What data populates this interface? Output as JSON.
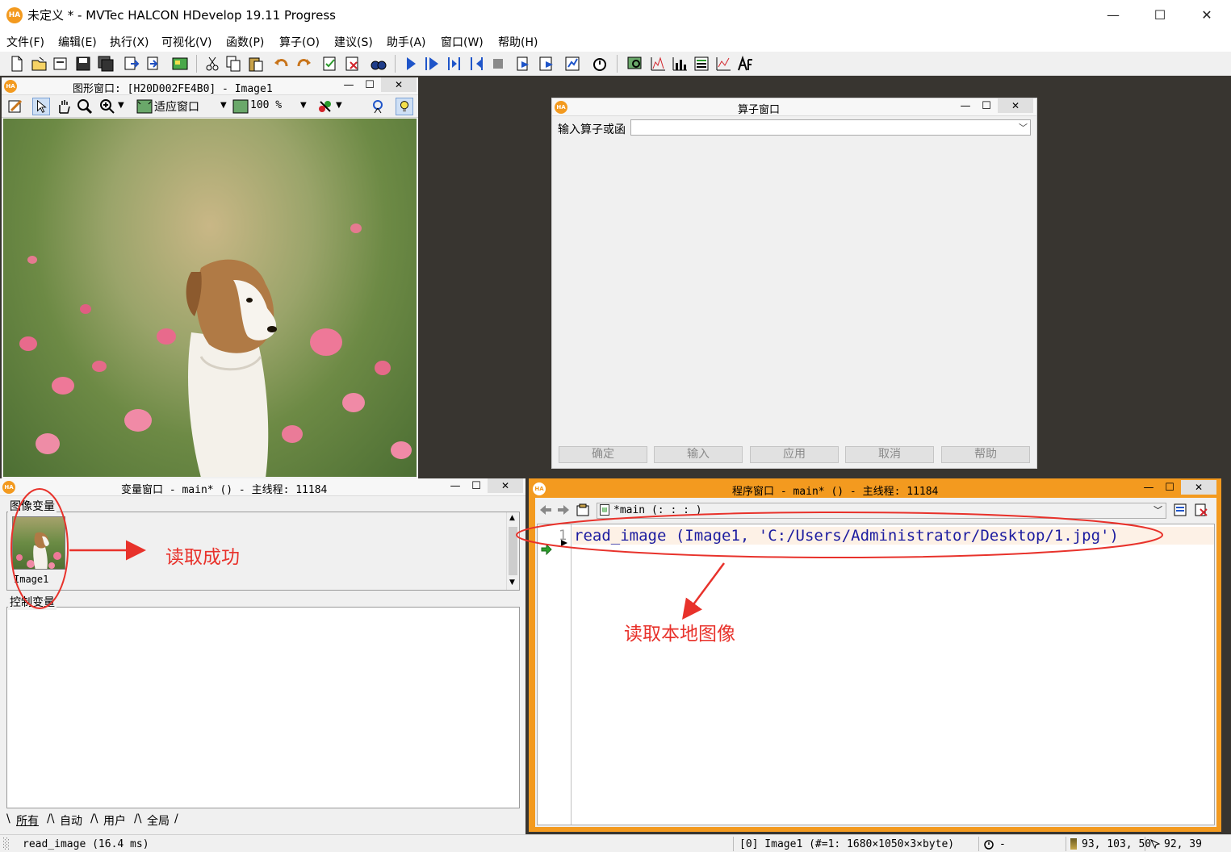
{
  "app": {
    "title": "未定义 * - MVTec HALCON HDevelop 19.11 Progress",
    "logo": "HA"
  },
  "window_controls": {
    "minimize": "—",
    "maximize": "☐",
    "close": "✕"
  },
  "menu": [
    "文件(F)",
    "编辑(E)",
    "执行(X)",
    "可视化(V)",
    "函数(P)",
    "算子(O)",
    "建议(S)",
    "助手(A)",
    "窗口(W)",
    "帮助(H)"
  ],
  "graphics_window": {
    "title": "图形窗口: [H20D002FE4B0] - Image1",
    "fit_label": "适应窗口",
    "zoom_label": "100 %"
  },
  "operator_window": {
    "title": "算子窗口",
    "input_label": "输入算子或函",
    "input_value": "",
    "buttons": [
      "确定",
      "输入",
      "应用",
      "取消",
      "帮助"
    ]
  },
  "variable_window": {
    "title": "变量窗口 - main* () - 主线程: 11184",
    "iconic_label": "图像变量",
    "control_label": "控制变量",
    "image_variable": "Image1",
    "tabs": [
      "所有",
      "自动",
      "用户",
      "全局"
    ]
  },
  "program_window": {
    "title": "程序窗口 - main* () - 主线程: 11184",
    "procedure": "*main (: : : )",
    "line_number": "1",
    "code_line": "read_image (Image1, 'C:/Users/Administrator/Desktop/1.jpg')"
  },
  "annotations": {
    "read_success": "读取成功",
    "read_local": "读取本地图像",
    "color": "#e8322b"
  },
  "status_bar": {
    "message": "read_image (16.4 ms)",
    "image_info": "[0] Image1 (#=1: 1680×1050×3×byte)",
    "timer": "-",
    "color_values": "93, 103, 50",
    "coordinates": "92,  39"
  },
  "colors": {
    "halcon_orange": "#f39a1f",
    "mdi_background": "#383530",
    "code_text": "#1c1ca0"
  }
}
